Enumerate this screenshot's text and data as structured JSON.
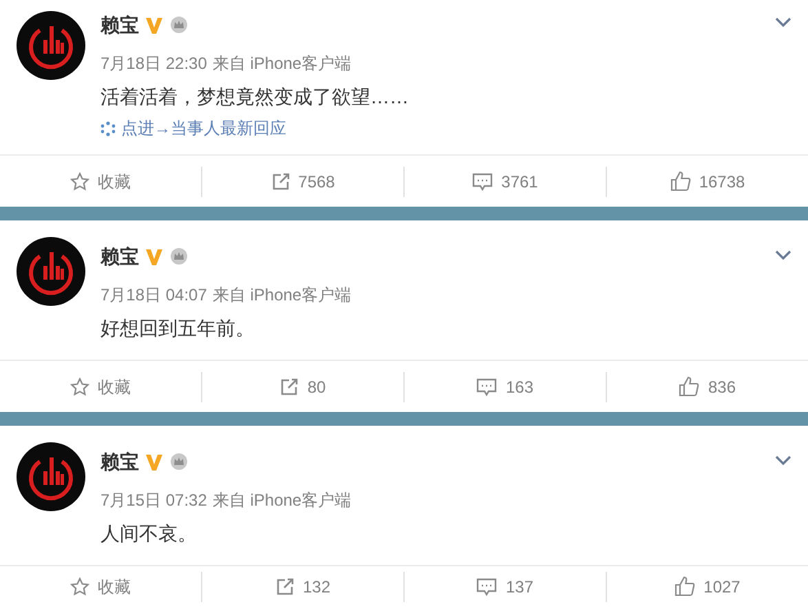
{
  "posts": [
    {
      "author": "赖宝",
      "verified": true,
      "time": "7月18日 22:30",
      "source": "来自 iPhone客户端",
      "text": "活着活着，梦想竟然变成了欲望……",
      "link": "点进→当事人最新回应",
      "actions": [
        {
          "kind": "favorite",
          "label": "收藏"
        },
        {
          "kind": "repost",
          "label": "7568"
        },
        {
          "kind": "comment",
          "label": "3761"
        },
        {
          "kind": "like",
          "label": "16738"
        }
      ]
    },
    {
      "author": "赖宝",
      "verified": true,
      "time": "7月18日 04:07",
      "source": "来自 iPhone客户端",
      "text": "好想回到五年前。",
      "actions": [
        {
          "kind": "favorite",
          "label": "收藏"
        },
        {
          "kind": "repost",
          "label": "80"
        },
        {
          "kind": "comment",
          "label": "163"
        },
        {
          "kind": "like",
          "label": "836"
        }
      ]
    },
    {
      "author": "赖宝",
      "verified": true,
      "time": "7月15日 07:32",
      "source": "来自 iPhone客户端",
      "text": "人间不哀。",
      "actions": [
        {
          "kind": "favorite",
          "label": "收藏"
        },
        {
          "kind": "repost",
          "label": "132"
        },
        {
          "kind": "comment",
          "label": "137"
        },
        {
          "kind": "like",
          "label": "1027"
        }
      ]
    }
  ]
}
